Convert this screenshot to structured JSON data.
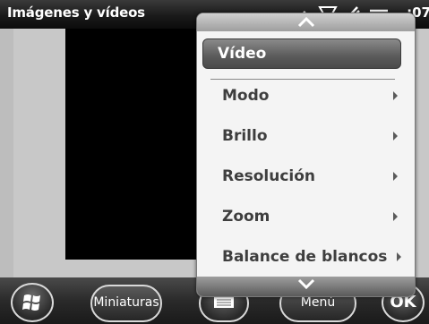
{
  "window": {
    "title": "Imágenes y vídeos"
  },
  "status": {
    "clock": ":07"
  },
  "menu": {
    "selected_label": "Vídeo",
    "items": [
      {
        "label": "Modo"
      },
      {
        "label": "Brillo"
      },
      {
        "label": "Resolución"
      },
      {
        "label": "Zoom"
      },
      {
        "label": "Balance de blancos"
      }
    ]
  },
  "bottombar": {
    "miniaturas_label": "Miniaturas",
    "menu_label": "Menú",
    "ok_label": "OK"
  }
}
